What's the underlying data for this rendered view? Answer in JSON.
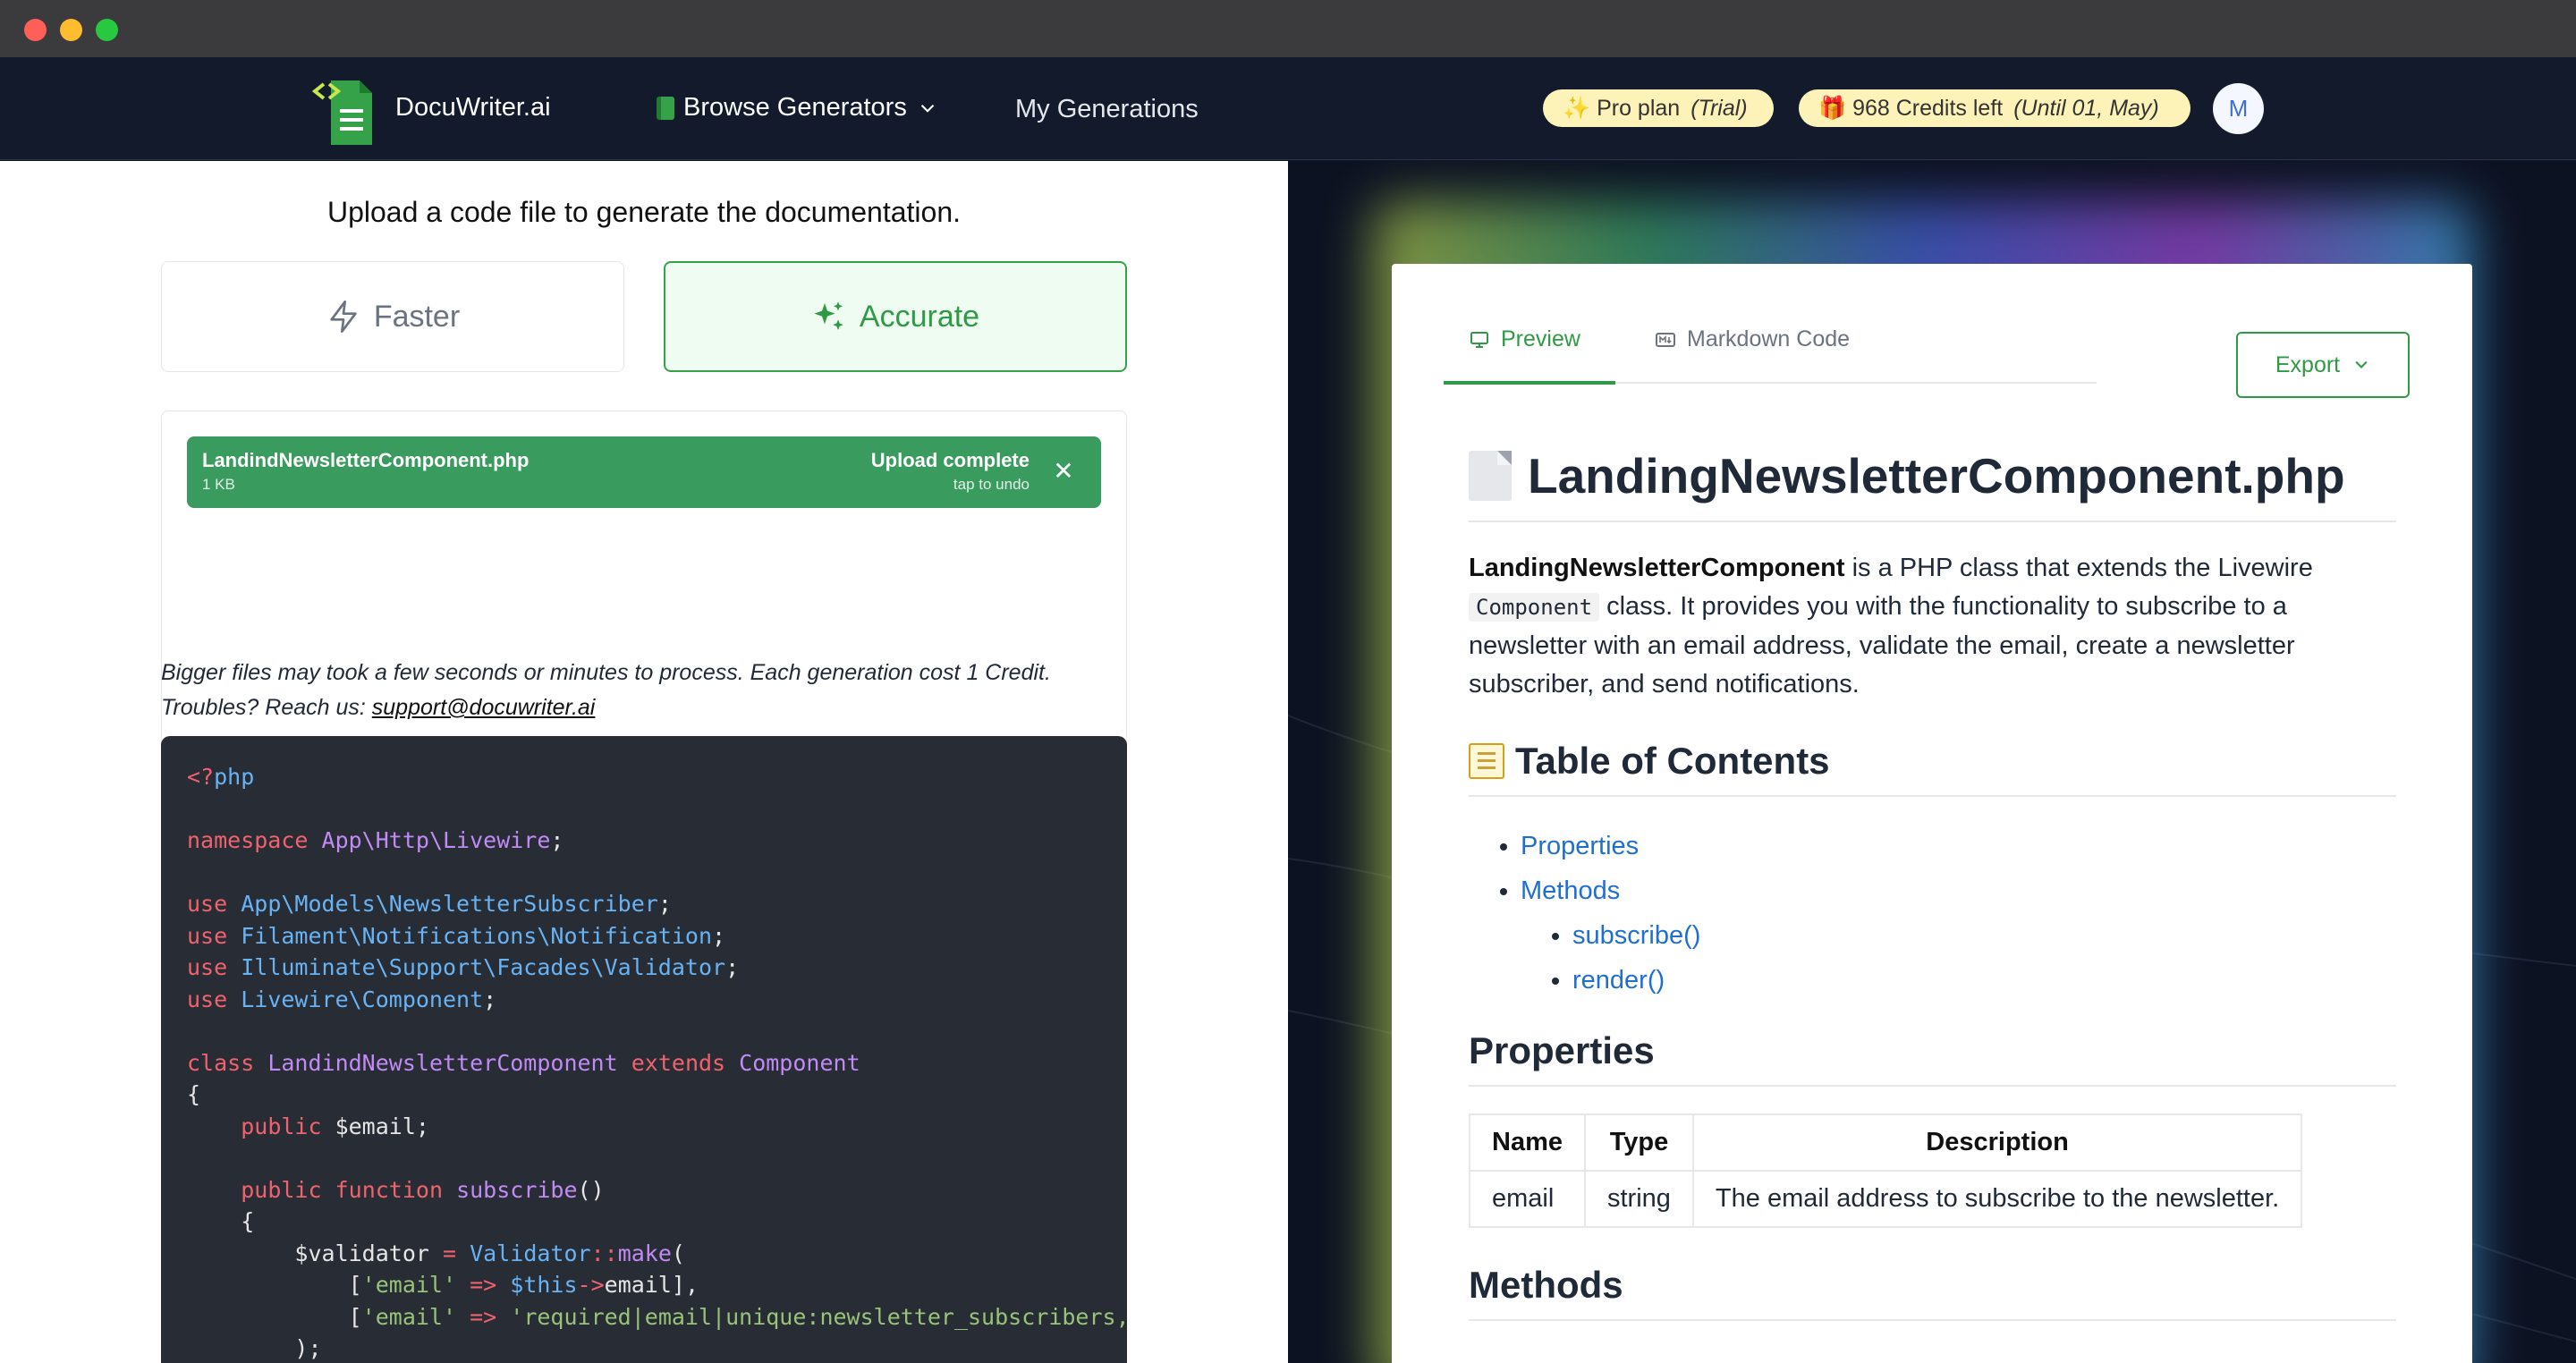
{
  "app": {
    "brand": "DocuWriter.ai",
    "nav_browse": "Browse Generators",
    "nav_generations": "My Generations",
    "pro_label": "✨ Pro plan",
    "pro_note": "(Trial)",
    "credits_label": "🎁 968 Credits left",
    "credits_note": "(Until 01, May)",
    "avatar_initial": "M"
  },
  "upload": {
    "title": "Upload a code file to generate the documentation.",
    "mode_faster": "Faster",
    "mode_accurate": "Accurate",
    "selected_mode": "Accurate",
    "file_name": "LandindNewsletterComponent.php",
    "file_size": "1 KB",
    "status": "Upload complete",
    "undo": "tap to undo",
    "close_symbol": "✕",
    "note_line1": "Bigger files may took a few seconds or minutes to process. Each generation cost 1 Credit.",
    "note_line2_prefix": "Troubles? Reach us: ",
    "support_email": "support@docuwriter.ai"
  },
  "preview": {
    "tab_preview": "Preview",
    "tab_markdown": "Markdown Code",
    "export_label": "Export",
    "doc_title": "LandingNewsletterComponent.php",
    "intro_class": "LandingNewsletterComponent",
    "intro_part1": " is a PHP class that extends the Livewire ",
    "intro_code": "Component",
    "intro_part2": " class. It provides you with the functionality to subscribe to a newsletter with an email address, validate the email, create a newsletter subscriber, and send notifications.",
    "toc_heading": "Table of Contents",
    "toc": {
      "properties": "Properties",
      "methods": "Methods",
      "subscribe": "subscribe()",
      "render": "render()"
    },
    "properties_heading": "Properties",
    "table_headers": [
      "Name",
      "Type",
      "Description"
    ],
    "table_rows": [
      [
        "email",
        "string",
        "The email address to subscribe to the newsletter."
      ]
    ],
    "methods_heading": "Methods"
  },
  "colors": {
    "accent_green": "#2f9a45",
    "navbar_bg": "#121a2c",
    "pill_bg": "#fdf3b8",
    "link_blue": "#1f6fd0",
    "code_bg": "#282c34"
  }
}
